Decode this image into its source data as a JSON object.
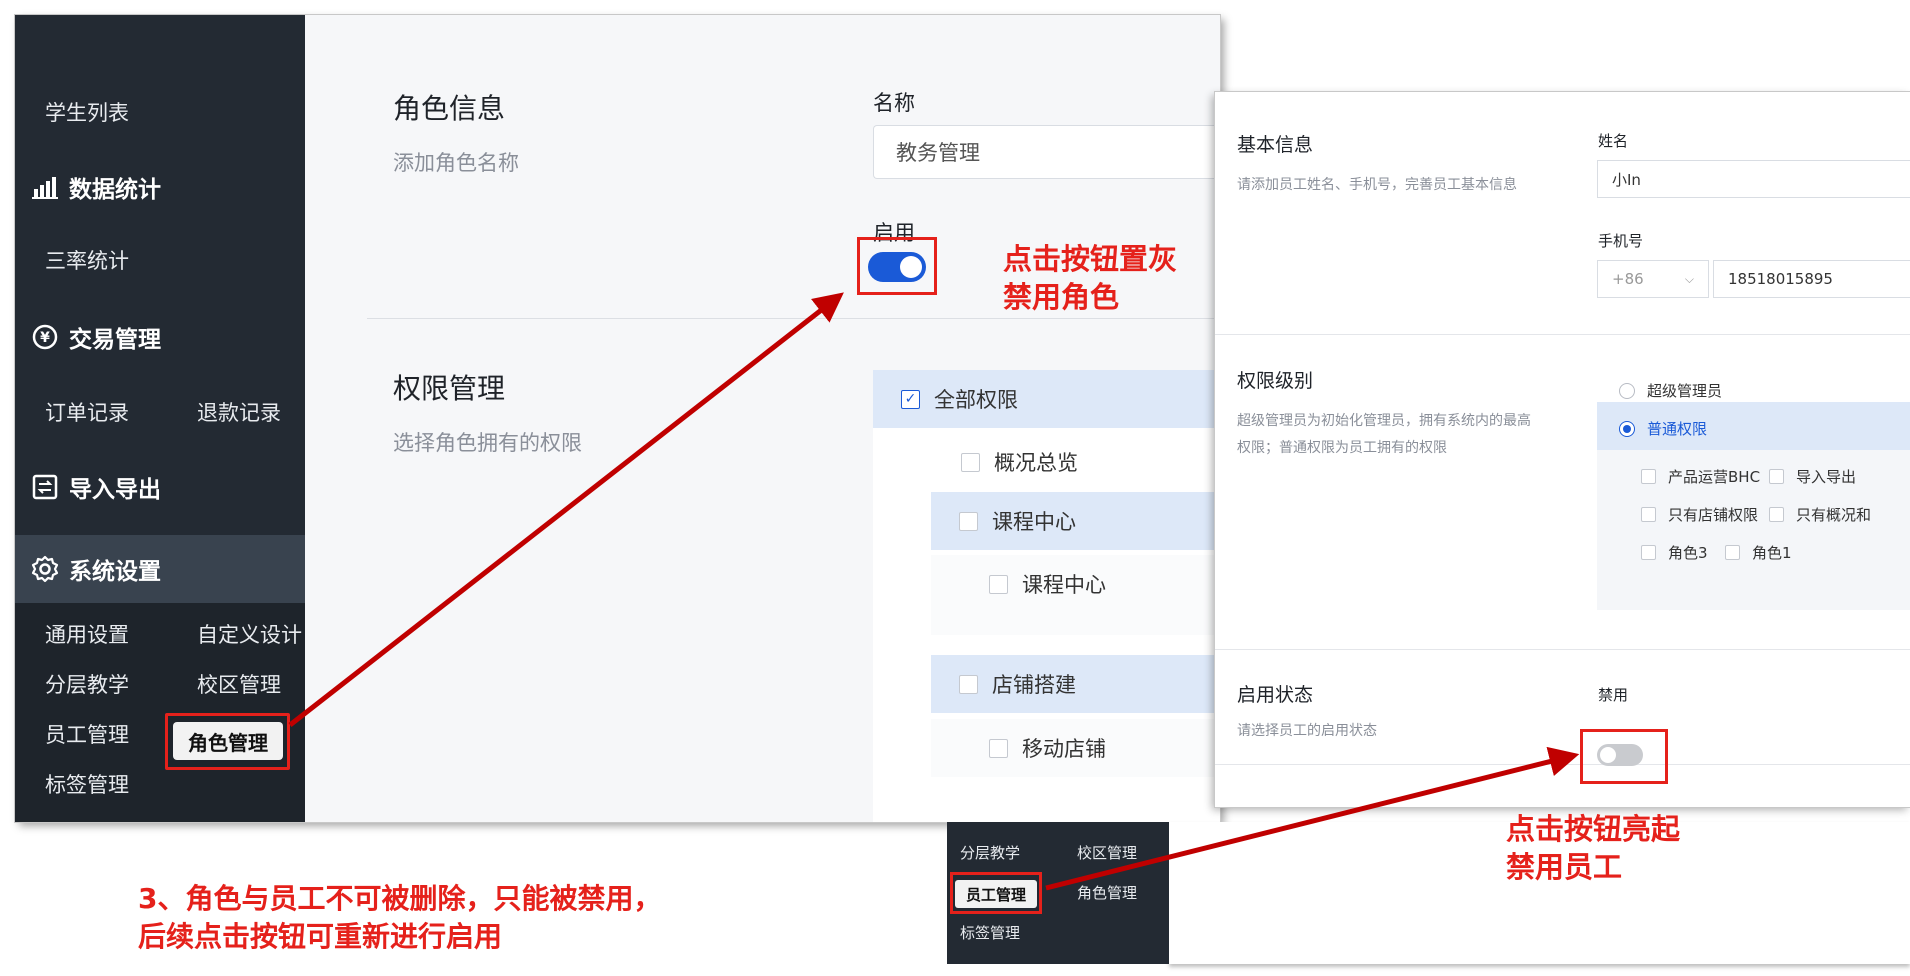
{
  "left_screen": {
    "sidebar": {
      "student_list": "学生列表",
      "data_stats": "数据统计",
      "three_rate": "三率统计",
      "trade_manage": "交易管理",
      "order_record": "订单记录",
      "refund_record": "退款记录",
      "import_export": "导入导出",
      "system_settings": "系统设置",
      "general_settings": "通用设置",
      "custom_design": "自定义设计",
      "layered_teaching": "分层教学",
      "campus_manage": "校区管理",
      "staff_manage": "员工管理",
      "role_manage": "角色管理",
      "tag_manage": "标签管理"
    },
    "role_info": {
      "title": "角色信息",
      "subtitle": "添加角色名称",
      "name_label": "名称",
      "name_value": "教务管理",
      "enable_label": "启用",
      "enabled": true
    },
    "permissions": {
      "title": "权限管理",
      "subtitle": "选择角色拥有的权限",
      "all": "全部权限",
      "overview": "概况总览",
      "course_center": "课程中心",
      "course_center_sub": "课程中心",
      "store_build": "店铺搭建",
      "mobile_store": "移动店铺"
    }
  },
  "right_screen": {
    "basic_info": {
      "title": "基本信息",
      "subtitle": "请添加员工姓名、手机号，完善员工基本信息",
      "name_label": "姓名",
      "name_value": "小In",
      "phone_label": "手机号",
      "country_code": "+86",
      "phone_value": "18518015895"
    },
    "permission_level": {
      "title": "权限级别",
      "subtitle": "超级管理员为初始化管理员，拥有系统内的最高权限；普通权限为员工拥有的权限",
      "super_admin": "超级管理员",
      "normal": "普通权限",
      "options": [
        "产品运营BHC",
        "导入导出",
        "只有店铺权限",
        "只有概况和",
        "角色3",
        "角色1"
      ]
    },
    "status": {
      "title": "启用状态",
      "subtitle": "请选择员工的启用状态",
      "label": "禁用",
      "enabled": false
    },
    "sidebar": {
      "layered_teaching": "分层教学",
      "campus_manage": "校区管理",
      "staff_manage": "员工管理",
      "role_manage": "角色管理",
      "tag_manage": "标签管理"
    }
  },
  "annotations": {
    "disable_role": [
      "点击按钮置灰",
      "禁用角色"
    ],
    "disable_staff": [
      "点击按钮亮起",
      "禁用员工"
    ],
    "note": [
      "3、角色与员工不可被删除，只能被禁用，",
      "后续点击按钮可重新进行启用"
    ],
    "accent_color": "#e5211b"
  },
  "colors": {
    "sidebar_bg": "#232a33",
    "primary_blue": "#1a5ad7",
    "highlight_row": "#dde8f8"
  }
}
